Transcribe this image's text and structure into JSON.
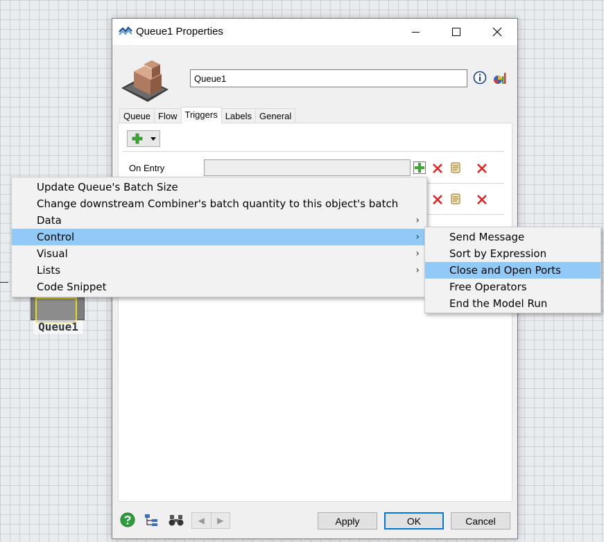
{
  "canvas": {
    "object_label": "Queue1"
  },
  "dialog": {
    "title": "Queue1  Properties",
    "name_value": "Queue1",
    "tabs": [
      {
        "label": "Queue",
        "active": false
      },
      {
        "label": "Flow",
        "active": false
      },
      {
        "label": "Triggers",
        "active": true
      },
      {
        "label": "Labels",
        "active": false
      },
      {
        "label": "General",
        "active": false
      }
    ],
    "triggers": [
      {
        "label": "On Entry"
      }
    ],
    "buttons": {
      "apply": "Apply",
      "ok": "OK",
      "cancel": "Cancel"
    }
  },
  "context_menu": {
    "items": [
      {
        "label": "Update Queue's Batch Size",
        "submenu": false,
        "highlighted": false
      },
      {
        "label": "Change downstream Combiner's batch quantity to this object's batch",
        "submenu": false,
        "highlighted": false
      },
      {
        "label": "Data",
        "submenu": true,
        "highlighted": false
      },
      {
        "label": "Control",
        "submenu": true,
        "highlighted": true
      },
      {
        "label": "Visual",
        "submenu": true,
        "highlighted": false
      },
      {
        "label": "Lists",
        "submenu": true,
        "highlighted": false
      },
      {
        "label": "Code Snippet",
        "submenu": false,
        "highlighted": false
      }
    ],
    "submenu_arrow": "›"
  },
  "submenu": {
    "items": [
      {
        "label": "Send Message",
        "highlighted": false
      },
      {
        "label": "Sort by Expression",
        "highlighted": false
      },
      {
        "label": "Close and Open Ports",
        "highlighted": true
      },
      {
        "label": "Free Operators",
        "highlighted": false
      },
      {
        "label": "End the Model Run",
        "highlighted": false
      }
    ]
  },
  "colors": {
    "highlight": "#91c9f7",
    "delete_red": "#e31c1c",
    "add_green": "#3fa535",
    "queue_outline": "#e6dd1b"
  }
}
